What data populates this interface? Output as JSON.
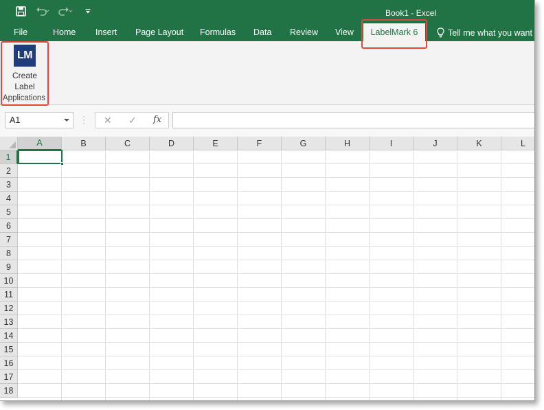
{
  "app": {
    "title": "Book1  -  Excel"
  },
  "quick_access": {
    "save_icon": "save-icon",
    "undo_icon": "undo-icon",
    "redo_icon": "redo-icon",
    "customize_icon": "customize-qat-icon"
  },
  "tabs": [
    {
      "label": "File"
    },
    {
      "label": "Home"
    },
    {
      "label": "Insert"
    },
    {
      "label": "Page Layout"
    },
    {
      "label": "Formulas"
    },
    {
      "label": "Data"
    },
    {
      "label": "Review"
    },
    {
      "label": "View"
    },
    {
      "label": "LabelMark 6",
      "selected": true
    }
  ],
  "tell_me": {
    "text": "Tell me what you want t",
    "icon": "lightbulb-icon"
  },
  "ribbon": {
    "logo_text": "LM",
    "button_line1": "Create",
    "button_line2": "Label",
    "group_label": "Applications"
  },
  "formula_bar": {
    "name_box": "A1",
    "cancel_glyph": "✕",
    "enter_glyph": "✓",
    "fx_label": "fx",
    "formula_value": ""
  },
  "sheet": {
    "columns": [
      "A",
      "B",
      "C",
      "D",
      "E",
      "F",
      "G",
      "H",
      "I",
      "J",
      "K",
      "L"
    ],
    "rows": [
      "1",
      "2",
      "3",
      "4",
      "5",
      "6",
      "7",
      "8",
      "9",
      "10",
      "11",
      "12",
      "13",
      "14",
      "15",
      "16",
      "17",
      "18"
    ],
    "active_cell": "A1"
  },
  "colors": {
    "excel_green": "#217346",
    "highlight_red": "#e0473f",
    "lm_logo_blue": "#1f3d7a"
  }
}
